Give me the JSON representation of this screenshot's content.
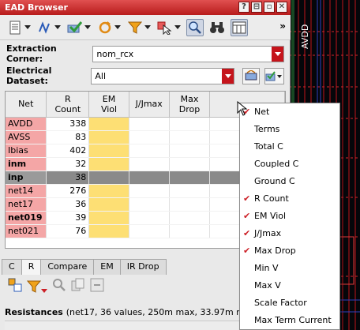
{
  "window": {
    "title": "EAD Browser"
  },
  "title_buttons": [
    "?",
    "⊟",
    "▫",
    "✕"
  ],
  "toolbar": {
    "more_label": "»"
  },
  "extraction_corner": {
    "label": "Extraction Corner:",
    "value": "nom_rcx"
  },
  "electrical_dataset": {
    "label": "Electrical Dataset:",
    "value": "All"
  },
  "table": {
    "headers": [
      "Net",
      "R\nCount",
      "EM\nViol",
      "J/Jmax",
      "Max\nDrop"
    ],
    "rows": [
      {
        "net": "AVDD",
        "r_count": "338",
        "bold": false,
        "em": true,
        "selected": false
      },
      {
        "net": "AVSS",
        "r_count": "83",
        "bold": false,
        "em": true,
        "selected": false
      },
      {
        "net": "Ibias",
        "r_count": "402",
        "bold": false,
        "em": true,
        "selected": false
      },
      {
        "net": "inm",
        "r_count": "32",
        "bold": true,
        "em": true,
        "selected": false
      },
      {
        "net": "inp",
        "r_count": "38",
        "bold": true,
        "em": false,
        "selected": true
      },
      {
        "net": "net14",
        "r_count": "276",
        "bold": false,
        "em": true,
        "selected": false
      },
      {
        "net": "net17",
        "r_count": "36",
        "bold": false,
        "em": true,
        "selected": false
      },
      {
        "net": "net019",
        "r_count": "39",
        "bold": true,
        "em": true,
        "selected": false
      },
      {
        "net": "net021",
        "r_count": "76",
        "bold": false,
        "em": true,
        "selected": false
      }
    ]
  },
  "tabs": [
    "C",
    "R",
    "Compare",
    "EM",
    "IR Drop"
  ],
  "active_tab": "R",
  "resistances": {
    "label": "Resistances",
    "details": "(net17, 36 values, 250m max, 33.97m min)"
  },
  "menu": {
    "items": [
      {
        "label": "Net",
        "checked": true
      },
      {
        "label": "Terms",
        "checked": false
      },
      {
        "label": "Total C",
        "checked": false
      },
      {
        "label": "Coupled C",
        "checked": false
      },
      {
        "label": "Ground C",
        "checked": false
      },
      {
        "label": "R Count",
        "checked": true
      },
      {
        "label": "EM Viol",
        "checked": true
      },
      {
        "label": "J/Jmax",
        "checked": true
      },
      {
        "label": "Max Drop",
        "checked": true
      },
      {
        "label": "Min V",
        "checked": false
      },
      {
        "label": "Max V",
        "checked": false
      },
      {
        "label": "Scale Factor",
        "checked": false
      },
      {
        "label": "Max Term Current",
        "checked": false
      }
    ]
  },
  "layout_text": "AVDD",
  "colors": {
    "accent": "#c5141b",
    "net_cell": "#f4a6a6",
    "em_cell": "#fddf74",
    "selected_row": "#8a8a8a"
  }
}
